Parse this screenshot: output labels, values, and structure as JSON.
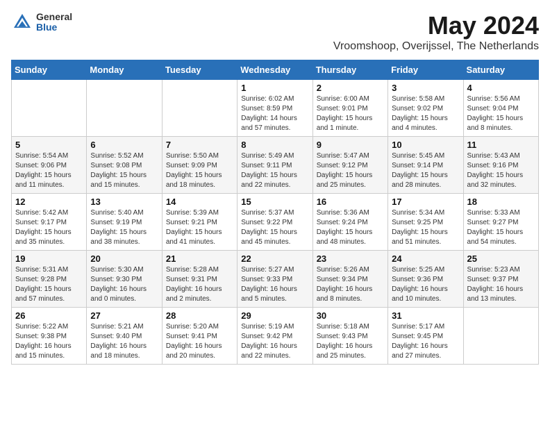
{
  "header": {
    "logo_general": "General",
    "logo_blue": "Blue",
    "month_title": "May 2024",
    "location": "Vroomshoop, Overijssel, The Netherlands"
  },
  "weekdays": [
    "Sunday",
    "Monday",
    "Tuesday",
    "Wednesday",
    "Thursday",
    "Friday",
    "Saturday"
  ],
  "weeks": [
    [
      {
        "day": "",
        "info": ""
      },
      {
        "day": "",
        "info": ""
      },
      {
        "day": "",
        "info": ""
      },
      {
        "day": "1",
        "info": "Sunrise: 6:02 AM\nSunset: 8:59 PM\nDaylight: 14 hours\nand 57 minutes."
      },
      {
        "day": "2",
        "info": "Sunrise: 6:00 AM\nSunset: 9:01 PM\nDaylight: 15 hours\nand 1 minute."
      },
      {
        "day": "3",
        "info": "Sunrise: 5:58 AM\nSunset: 9:02 PM\nDaylight: 15 hours\nand 4 minutes."
      },
      {
        "day": "4",
        "info": "Sunrise: 5:56 AM\nSunset: 9:04 PM\nDaylight: 15 hours\nand 8 minutes."
      }
    ],
    [
      {
        "day": "5",
        "info": "Sunrise: 5:54 AM\nSunset: 9:06 PM\nDaylight: 15 hours\nand 11 minutes."
      },
      {
        "day": "6",
        "info": "Sunrise: 5:52 AM\nSunset: 9:08 PM\nDaylight: 15 hours\nand 15 minutes."
      },
      {
        "day": "7",
        "info": "Sunrise: 5:50 AM\nSunset: 9:09 PM\nDaylight: 15 hours\nand 18 minutes."
      },
      {
        "day": "8",
        "info": "Sunrise: 5:49 AM\nSunset: 9:11 PM\nDaylight: 15 hours\nand 22 minutes."
      },
      {
        "day": "9",
        "info": "Sunrise: 5:47 AM\nSunset: 9:12 PM\nDaylight: 15 hours\nand 25 minutes."
      },
      {
        "day": "10",
        "info": "Sunrise: 5:45 AM\nSunset: 9:14 PM\nDaylight: 15 hours\nand 28 minutes."
      },
      {
        "day": "11",
        "info": "Sunrise: 5:43 AM\nSunset: 9:16 PM\nDaylight: 15 hours\nand 32 minutes."
      }
    ],
    [
      {
        "day": "12",
        "info": "Sunrise: 5:42 AM\nSunset: 9:17 PM\nDaylight: 15 hours\nand 35 minutes."
      },
      {
        "day": "13",
        "info": "Sunrise: 5:40 AM\nSunset: 9:19 PM\nDaylight: 15 hours\nand 38 minutes."
      },
      {
        "day": "14",
        "info": "Sunrise: 5:39 AM\nSunset: 9:21 PM\nDaylight: 15 hours\nand 41 minutes."
      },
      {
        "day": "15",
        "info": "Sunrise: 5:37 AM\nSunset: 9:22 PM\nDaylight: 15 hours\nand 45 minutes."
      },
      {
        "day": "16",
        "info": "Sunrise: 5:36 AM\nSunset: 9:24 PM\nDaylight: 15 hours\nand 48 minutes."
      },
      {
        "day": "17",
        "info": "Sunrise: 5:34 AM\nSunset: 9:25 PM\nDaylight: 15 hours\nand 51 minutes."
      },
      {
        "day": "18",
        "info": "Sunrise: 5:33 AM\nSunset: 9:27 PM\nDaylight: 15 hours\nand 54 minutes."
      }
    ],
    [
      {
        "day": "19",
        "info": "Sunrise: 5:31 AM\nSunset: 9:28 PM\nDaylight: 15 hours\nand 57 minutes."
      },
      {
        "day": "20",
        "info": "Sunrise: 5:30 AM\nSunset: 9:30 PM\nDaylight: 16 hours\nand 0 minutes."
      },
      {
        "day": "21",
        "info": "Sunrise: 5:28 AM\nSunset: 9:31 PM\nDaylight: 16 hours\nand 2 minutes."
      },
      {
        "day": "22",
        "info": "Sunrise: 5:27 AM\nSunset: 9:33 PM\nDaylight: 16 hours\nand 5 minutes."
      },
      {
        "day": "23",
        "info": "Sunrise: 5:26 AM\nSunset: 9:34 PM\nDaylight: 16 hours\nand 8 minutes."
      },
      {
        "day": "24",
        "info": "Sunrise: 5:25 AM\nSunset: 9:36 PM\nDaylight: 16 hours\nand 10 minutes."
      },
      {
        "day": "25",
        "info": "Sunrise: 5:23 AM\nSunset: 9:37 PM\nDaylight: 16 hours\nand 13 minutes."
      }
    ],
    [
      {
        "day": "26",
        "info": "Sunrise: 5:22 AM\nSunset: 9:38 PM\nDaylight: 16 hours\nand 15 minutes."
      },
      {
        "day": "27",
        "info": "Sunrise: 5:21 AM\nSunset: 9:40 PM\nDaylight: 16 hours\nand 18 minutes."
      },
      {
        "day": "28",
        "info": "Sunrise: 5:20 AM\nSunset: 9:41 PM\nDaylight: 16 hours\nand 20 minutes."
      },
      {
        "day": "29",
        "info": "Sunrise: 5:19 AM\nSunset: 9:42 PM\nDaylight: 16 hours\nand 22 minutes."
      },
      {
        "day": "30",
        "info": "Sunrise: 5:18 AM\nSunset: 9:43 PM\nDaylight: 16 hours\nand 25 minutes."
      },
      {
        "day": "31",
        "info": "Sunrise: 5:17 AM\nSunset: 9:45 PM\nDaylight: 16 hours\nand 27 minutes."
      },
      {
        "day": "",
        "info": ""
      }
    ]
  ]
}
